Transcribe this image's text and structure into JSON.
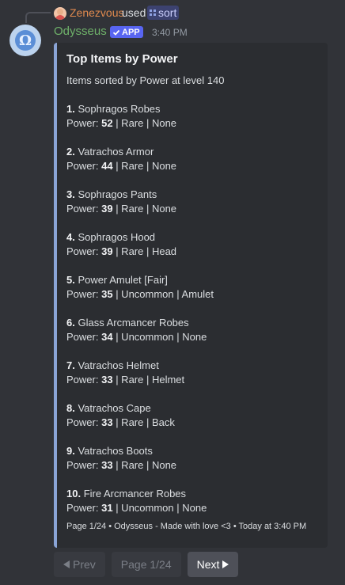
{
  "reply": {
    "user": "Zenezvous",
    "used_text": "used",
    "command": "sort",
    "user_color": "#e08a4e"
  },
  "message": {
    "author": "Odysseus",
    "author_color": "#6fb26a",
    "badge": "APP",
    "time": "3:40 PM",
    "avatar_glyph": "Ω"
  },
  "embed": {
    "accent": "#8aa4d6",
    "title": "Top Items by Power",
    "subtitle": "Items sorted by Power at level 140",
    "items": [
      {
        "rank": "1.",
        "name": "Sophragos Robes",
        "label": "Power:",
        "power": "52",
        "rest": "| Rare | None"
      },
      {
        "rank": "2.",
        "name": "Vatrachos Armor",
        "label": "Power:",
        "power": "44",
        "rest": "| Rare | None"
      },
      {
        "rank": "3.",
        "name": "Sophragos Pants",
        "label": "Power:",
        "power": "39",
        "rest": "| Rare | None"
      },
      {
        "rank": "4.",
        "name": "Sophragos Hood",
        "label": "Power:",
        "power": "39",
        "rest": "| Rare | Head"
      },
      {
        "rank": "5.",
        "name": "Power Amulet [Fair]",
        "label": "Power:",
        "power": "35",
        "rest": "| Uncommon | Amulet"
      },
      {
        "rank": "6.",
        "name": "Glass Arcmancer Robes",
        "label": "Power:",
        "power": "34",
        "rest": "| Uncommon | None"
      },
      {
        "rank": "7.",
        "name": "Vatrachos Helmet",
        "label": "Power:",
        "power": "33",
        "rest": "| Rare | Helmet"
      },
      {
        "rank": "8.",
        "name": "Vatrachos Cape",
        "label": "Power:",
        "power": "33",
        "rest": "| Rare | Back"
      },
      {
        "rank": "9.",
        "name": "Vatrachos Boots",
        "label": "Power:",
        "power": "33",
        "rest": "| Rare | None"
      },
      {
        "rank": "10.",
        "name": "Fire Arcmancer Robes",
        "label": "Power:",
        "power": "31",
        "rest": "| Uncommon | None"
      }
    ],
    "footer": "Page 1/24 • Odysseus - Made with love <3 • Today at 3:40 PM"
  },
  "buttons": {
    "prev": "Prev",
    "page": "Page 1/24",
    "next": "Next"
  },
  "icons": {
    "command": "slash-command-icon",
    "badge_check": "check-icon",
    "prev": "arrow-left-icon",
    "next": "arrow-right-icon"
  }
}
